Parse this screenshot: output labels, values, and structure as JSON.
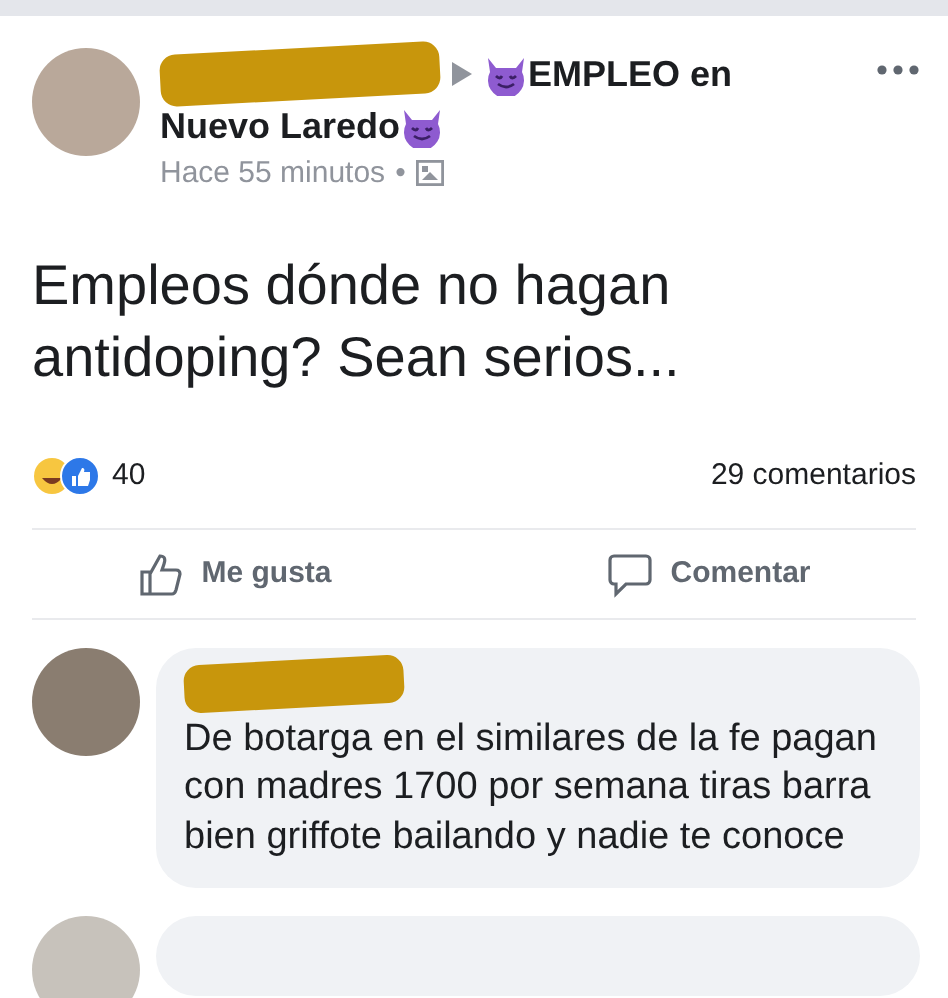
{
  "post": {
    "group_name_line_1": "EMPLEO en",
    "group_name_line_2": "Nuevo Laredo",
    "time": "Hace 55 minutos",
    "separator": "•",
    "text": "Empleos dónde no hagan antidoping? Sean serios...",
    "reaction_count": "40",
    "comment_count": "29 comentarios"
  },
  "actions": [
    {
      "kind": "like",
      "label": "Me gusta"
    },
    {
      "kind": "comment",
      "label": "Comentar"
    }
  ],
  "comments": [
    {
      "text": "De botarga en el similares de la fe pagan con madres 1700 por semana tiras barra bien griffote bailando y nadie te conoce"
    }
  ]
}
